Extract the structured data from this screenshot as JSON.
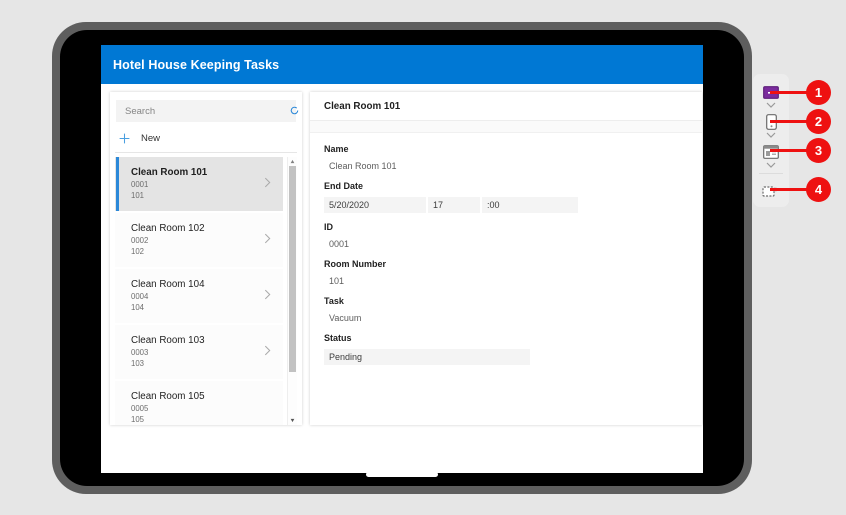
{
  "app": {
    "title": "Hotel House Keeping Tasks",
    "accent_color": "#0078d4",
    "callout_color": "#ee1111"
  },
  "gallery": {
    "search": {
      "placeholder": "Search",
      "value": "",
      "refresh_icon": "refresh-icon"
    },
    "new_button": {
      "label": "New",
      "icon": "plus-icon"
    },
    "items": [
      {
        "title": "Clean Room 101",
        "id": "0001",
        "room": "101",
        "selected": true
      },
      {
        "title": "Clean Room 102",
        "id": "0002",
        "room": "102",
        "selected": false
      },
      {
        "title": "Clean Room 104",
        "id": "0004",
        "room": "104",
        "selected": false
      },
      {
        "title": "Clean Room 103",
        "id": "0003",
        "room": "103",
        "selected": false
      },
      {
        "title": "Clean Room 105",
        "id": "0005",
        "room": "105",
        "selected": false
      }
    ]
  },
  "detail": {
    "header_title": "Clean Room 101",
    "fields": {
      "name_label": "Name",
      "name_value": "Clean Room 101",
      "end_date_label": "End Date",
      "end_date_value": "5/20/2020",
      "end_hour_value": "17",
      "end_minute_value": ":00",
      "id_label": "ID",
      "id_value": "0001",
      "room_number_label": "Room Number",
      "room_number_value": "101",
      "task_label": "Task",
      "task_value": "Vacuum",
      "status_label": "Status",
      "status_value": "Pending"
    }
  },
  "callouts": [
    {
      "number": "1",
      "icon": "monitor-icon"
    },
    {
      "number": "2",
      "icon": "phone-icon"
    },
    {
      "number": "3",
      "icon": "card-icon"
    },
    {
      "number": "4",
      "icon": "dashed-folder-icon"
    }
  ]
}
